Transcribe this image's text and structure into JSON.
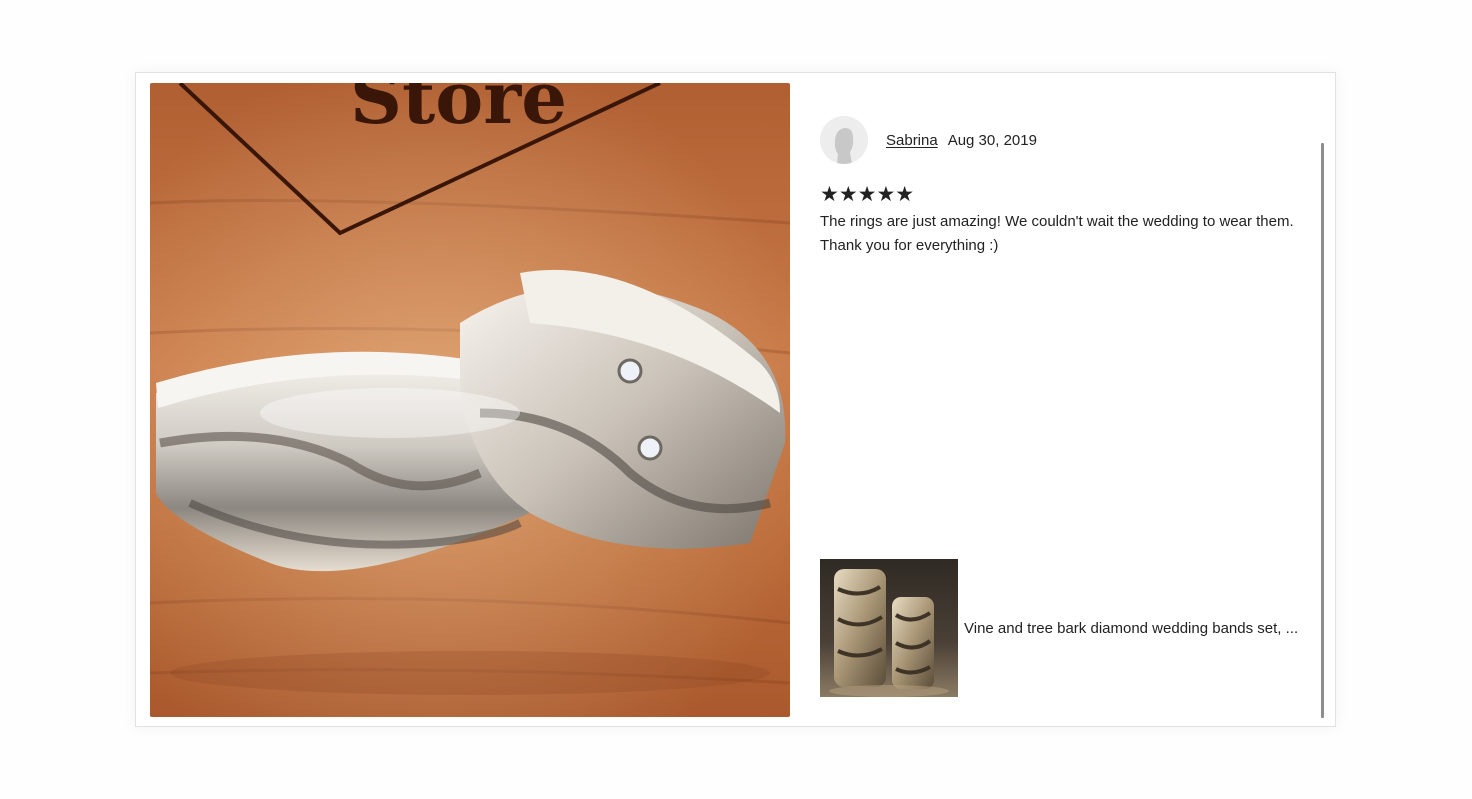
{
  "review": {
    "reviewer_name": "Sabrina",
    "date": "Aug 30, 2019",
    "rating": 5,
    "stars_text": "★★★★★",
    "text": "The rings are just amazing! We couldn't wait the wedding to wear them. Thank you for everything :)"
  },
  "photo": {
    "sign_text": "Store"
  },
  "product": {
    "title": "Vine and tree bark diamond wedding bands set, ..."
  },
  "colors": {
    "wood": "#b8683a",
    "wood_dark": "#7a3b1c",
    "silver": "#d9d4cc",
    "text": "#222222",
    "scrollbar": "#8e8e8e"
  }
}
